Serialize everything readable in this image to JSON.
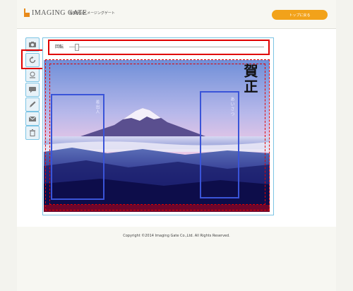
{
  "header": {
    "logo_text": "IMAGING GATE",
    "tagline": "年賀状はイメージングゲート",
    "top_button_label": "トップに戻る",
    "accent_color": "#f2a21a"
  },
  "toolbar": {
    "tools": [
      {
        "icon": "camera-icon",
        "label": ""
      },
      {
        "icon": "rotate-icon",
        "label": ""
      },
      {
        "icon": "stamp-icon",
        "label": ""
      },
      {
        "icon": "speech-bubble-icon",
        "label": ""
      },
      {
        "icon": "pen-icon",
        "label": ""
      },
      {
        "icon": "envelope-icon",
        "label": ""
      },
      {
        "icon": "trash-icon",
        "label": ""
      }
    ]
  },
  "editor": {
    "rotate_label": "回転",
    "greeting": "賀正",
    "right_vertical_text": "あいさつ",
    "left_vertical_text": "差出人",
    "frame_color": "#e00000",
    "text_box_color": "#3a54d8"
  },
  "footer": {
    "copyright": "Copyright ©2014 Imaging Gate Co.,Ltd. All Rights Reserved."
  }
}
